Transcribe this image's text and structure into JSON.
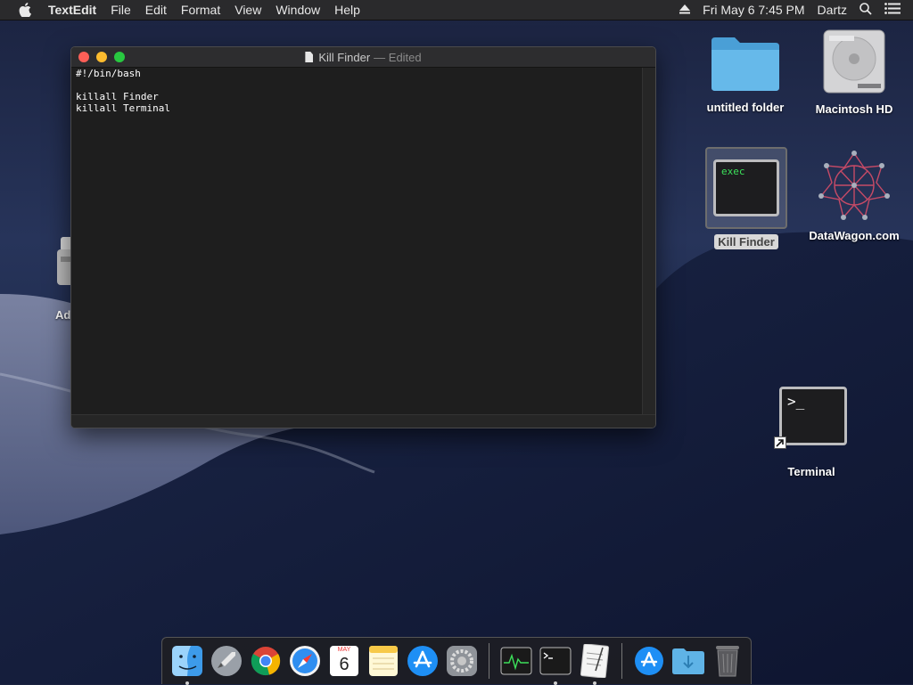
{
  "menubar": {
    "app_name": "TextEdit",
    "items": [
      "File",
      "Edit",
      "Format",
      "View",
      "Window",
      "Help"
    ],
    "clock": "Fri May 6  7:45 PM",
    "user": "Dartz"
  },
  "window": {
    "title": "Kill Finder",
    "title_suffix": "— Edited",
    "content": "#!/bin/bash\n\nkillall Finder\nkillall Terminal"
  },
  "desktop": {
    "icons": {
      "untitled_folder": "untitled folder",
      "macintosh_hd": "Macintosh HD",
      "kill_finder": "Kill Finder",
      "kill_finder_preview": "exec",
      "datawagon": "DataWagon.com",
      "terminal": "Terminal",
      "terminal_preview": ">_",
      "partial_left": "Ad"
    }
  },
  "dock": {
    "apps": [
      "finder-icon",
      "launchpad-icon",
      "chrome-icon",
      "safari-icon",
      "calendar-icon",
      "notes-icon",
      "app-store-icon",
      "system-preferences-icon",
      "activity-monitor-icon",
      "terminal-icon",
      "textedit-icon",
      "app-store-downloads-icon",
      "downloads-folder-icon",
      "trash-icon"
    ],
    "calendar_month": "MAY",
    "calendar_day": "6"
  },
  "colors": {
    "close": "#fc5f57",
    "minimize": "#fdbc2e",
    "zoom": "#28c840",
    "folder_blue": "#5fb3e6"
  }
}
